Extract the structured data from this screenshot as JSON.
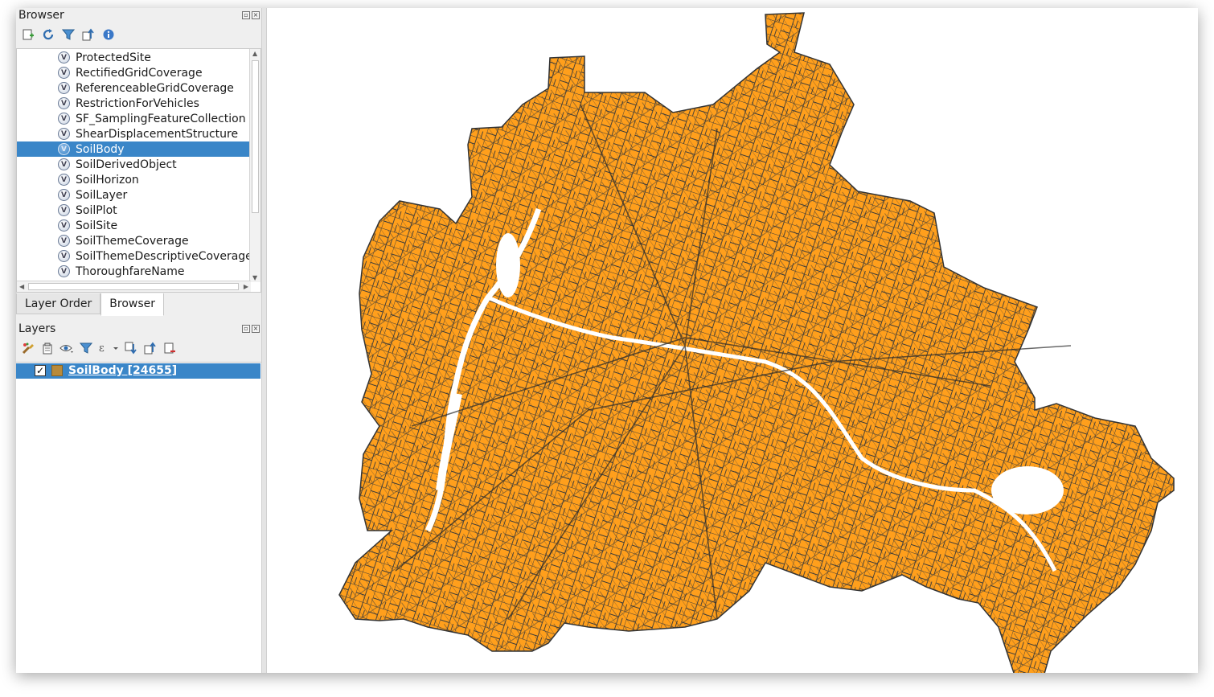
{
  "browser_panel": {
    "title": "Browser",
    "items": [
      {
        "label": "ProtectedSite"
      },
      {
        "label": "RectifiedGridCoverage"
      },
      {
        "label": "ReferenceableGridCoverage"
      },
      {
        "label": "RestrictionForVehicles"
      },
      {
        "label": "SF_SamplingFeatureCollection"
      },
      {
        "label": "ShearDisplacementStructure"
      },
      {
        "label": "SoilBody",
        "selected": true
      },
      {
        "label": "SoilDerivedObject"
      },
      {
        "label": "SoilHorizon"
      },
      {
        "label": "SoilLayer"
      },
      {
        "label": "SoilPlot"
      },
      {
        "label": "SoilSite"
      },
      {
        "label": "SoilThemeCoverage"
      },
      {
        "label": "SoilThemeDescriptiveCoverage"
      },
      {
        "label": "ThoroughfareName"
      }
    ]
  },
  "tabs": [
    {
      "label": "Layer Order",
      "active": false
    },
    {
      "label": "Browser",
      "active": true
    }
  ],
  "layers_panel": {
    "title": "Layers",
    "layers": [
      {
        "name": "SoilBody [24655]",
        "visible": true,
        "fill_color": "#b88a3a"
      }
    ]
  },
  "map": {
    "fill_color": "#ff9f1c",
    "stroke_color": "#3a3a3a"
  }
}
